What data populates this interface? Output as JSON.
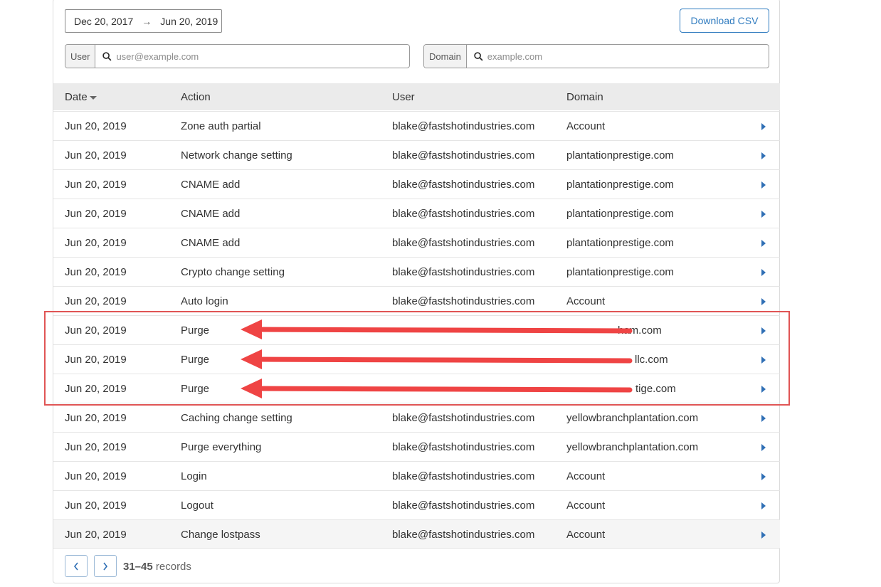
{
  "filters": {
    "date_from": "Dec 20, 2017",
    "date_arrow": "→",
    "date_to": "Jun 20, 2019",
    "download_label": "Download CSV",
    "user_label": "User",
    "user_placeholder": "user@example.com",
    "domain_label": "Domain",
    "domain_placeholder": "example.com"
  },
  "table": {
    "headers": [
      "Date",
      "Action",
      "User",
      "Domain"
    ],
    "sort": "Date descending",
    "rows": [
      [
        "Jun 20, 2019",
        "Zone auth partial",
        "blake@fastshotindustries.com",
        "Account"
      ],
      [
        "Jun 20, 2019",
        "Network change setting",
        "blake@fastshotindustries.com",
        "plantationprestige.com"
      ],
      [
        "Jun 20, 2019",
        "CNAME add",
        "blake@fastshotindustries.com",
        "plantationprestige.com"
      ],
      [
        "Jun 20, 2019",
        "CNAME add",
        "blake@fastshotindustries.com",
        "plantationprestige.com"
      ],
      [
        "Jun 20, 2019",
        "CNAME add",
        "blake@fastshotindustries.com",
        "plantationprestige.com"
      ],
      [
        "Jun 20, 2019",
        "Crypto change setting",
        "blake@fastshotindustries.com",
        "plantationprestige.com"
      ],
      [
        "Jun 20, 2019",
        "Auto login",
        "blake@fastshotindustries.com",
        "Account"
      ],
      [
        "Jun 20, 2019",
        "Purge",
        "",
        "ham.com"
      ],
      [
        "Jun 20, 2019",
        "Purge",
        "",
        "llc.com"
      ],
      [
        "Jun 20, 2019",
        "Purge",
        "",
        "tige.com"
      ],
      [
        "Jun 20, 2019",
        "Caching change setting",
        "blake@fastshotindustries.com",
        "yellowbranchplantation.com"
      ],
      [
        "Jun 20, 2019",
        "Purge everything",
        "blake@fastshotindustries.com",
        "yellowbranchplantation.com"
      ],
      [
        "Jun 20, 2019",
        "Login",
        "blake@fastshotindustries.com",
        "Account"
      ],
      [
        "Jun 20, 2019",
        "Logout",
        "blake@fastshotindustries.com",
        "Account"
      ],
      [
        "Jun 20, 2019",
        "Change lostpass",
        "blake@fastshotindustries.com",
        "Account"
      ]
    ]
  },
  "pagination": {
    "prev_icon": "chevron-left-icon",
    "next_icon": "chevron-right-icon",
    "range": "31–45",
    "suffix": " records"
  },
  "annotation": {
    "highlight_color": "#e05555",
    "arrow_color": "#ef4444"
  },
  "colors": {
    "accent": "#2f7bbf",
    "header_bg": "#ebebeb"
  }
}
